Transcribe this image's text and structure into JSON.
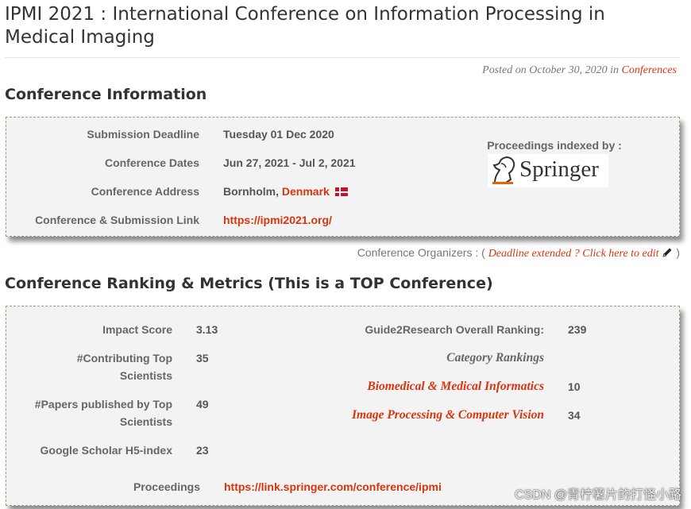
{
  "page": {
    "title": "IPMI 2021 : International Conference on Information Processing in Medical Imaging",
    "posted_prefix": "Posted on October 30, 2020 in",
    "posted_category": "Conferences"
  },
  "conference_info": {
    "heading": "Conference Information",
    "rows": [
      {
        "label": "Submission Deadline",
        "value": "Tuesday 01 Dec 2020"
      },
      {
        "label": "Conference Dates",
        "value": "Jun 27, 2021 - Jul 2, 2021"
      },
      {
        "label": "Conference Address",
        "value": "Bornholm,",
        "link": "Denmark"
      },
      {
        "label": "Conference & Submission Link",
        "link": "https://ipmi2021.org/"
      }
    ],
    "proceedings_label": "Proceedings indexed by :",
    "publisher_logo": "Springer"
  },
  "organizers": {
    "prefix": "Conference Organizers : (",
    "edit_link": "Deadline extended ? Click here to edit",
    "edit_icon": "pencil-icon",
    "suffix": ")"
  },
  "metrics": {
    "heading": "Conference Ranking & Metrics (This is a TOP Conference)",
    "left": [
      {
        "label": "Impact Score",
        "value": "3.13"
      },
      {
        "label": "#Contributing Top Scientists",
        "value": "35"
      },
      {
        "label": "#Papers published by Top Scientists",
        "value": "49"
      },
      {
        "label": "Google Scholar H5-index",
        "value": "23"
      }
    ],
    "overall_label": "Guide2Research Overall Ranking:",
    "overall_value": "239",
    "category_heading": "Category Rankings",
    "categories": [
      {
        "name": "Biomedical & Medical Informatics",
        "value": "10"
      },
      {
        "name": "Image Processing & Computer Vision",
        "value": "34"
      }
    ],
    "proceedings_label": "Proceedings",
    "proceedings_link": "https://link.springer.com/conference/ipmi"
  },
  "watermark": "CSDN @青柠薯片的打怪小路",
  "colors": {
    "accent": "#d8350d",
    "box_bg": "#f3f3f3",
    "box_border": "#aa9a7c"
  }
}
